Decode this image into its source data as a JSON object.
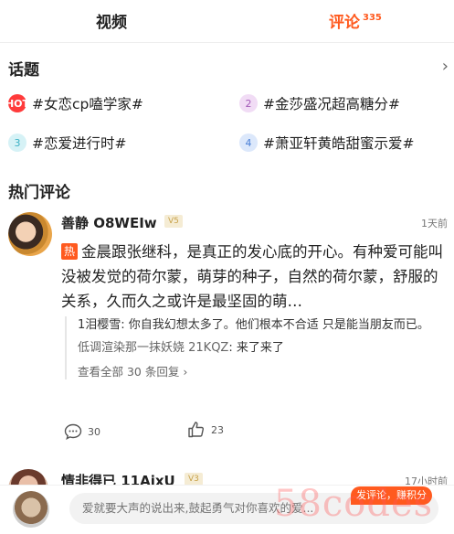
{
  "tabs": {
    "video": "视频",
    "comments": "评论",
    "comments_count": "335"
  },
  "topics": {
    "title": "话题",
    "items": [
      {
        "badge": "HOT",
        "label": "#女恋cp嗑学家#"
      },
      {
        "badge": "2",
        "label": "#金莎盛况超高糖分#"
      },
      {
        "badge": "3",
        "label": "#恋爱进行时#"
      },
      {
        "badge": "4",
        "label": "#萧亚轩黄皓甜蜜示爱#"
      }
    ]
  },
  "hot_comments": {
    "title": "热门评论",
    "first": {
      "user": "善静 O8WEIw",
      "level": "V5",
      "time": "1天前",
      "hot_tag": "热",
      "text": "金晨跟张继科，是真正的发心底的开心。有种爱可能叫没被发觉的荷尔蒙，萌芽的种子，自然的荷尔蒙，舒服的关系，久而久之或许是最坚固的萌…",
      "replies": [
        {
          "name": "1泪樱雪",
          "sep": ": ",
          "text": "你自我幻想太多了。他们根本不合适  只是能当朋友而已。"
        },
        {
          "name": "低调渲染那一抹妖娆 21KQZ",
          "sep": ": ",
          "text": "来了来了"
        }
      ],
      "view_all": "查看全部 30 条回复",
      "view_all_arrow": "›",
      "comment_count": "30",
      "like_count": "23"
    },
    "second": {
      "user": "情非得已 11AixU",
      "level": "V3",
      "time": "17小时前"
    }
  },
  "bottom": {
    "placeholder": "爱就要大声的说出来,鼓起勇气对你喜欢的爱...",
    "earn_button": "发评论，赚积分",
    "watermark": "58codes"
  },
  "colors": {
    "accent": "#ff5a1f"
  }
}
